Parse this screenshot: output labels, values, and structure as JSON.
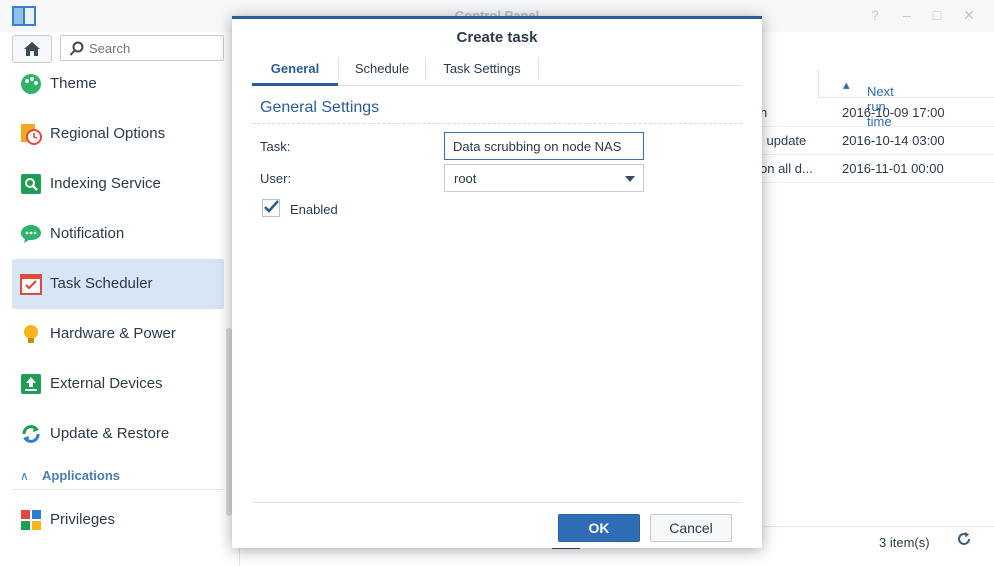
{
  "window": {
    "title": "Control Panel",
    "controls": [
      "?",
      "–",
      "□",
      "✕"
    ]
  },
  "sidebar": {
    "search_placeholder": "Search",
    "items": [
      {
        "label": "Theme",
        "icon": "palette-icon"
      },
      {
        "label": "Regional Options",
        "icon": "regional-clock-icon"
      },
      {
        "label": "Indexing Service",
        "icon": "indexing-search-icon"
      },
      {
        "label": "Notification",
        "icon": "chat-bubble-icon"
      },
      {
        "label": "Task Scheduler",
        "icon": "calendar-check-icon",
        "active": true
      },
      {
        "label": "Hardware & Power",
        "icon": "lightbulb-icon"
      },
      {
        "label": "External Devices",
        "icon": "upload-device-icon"
      },
      {
        "label": "Update & Restore",
        "icon": "refresh-cycle-icon"
      }
    ],
    "section": {
      "label": "Applications"
    },
    "apps": [
      {
        "label": "Privileges",
        "icon": "privileges-grid-icon"
      }
    ]
  },
  "content": {
    "columns": {
      "next_run": "Next run time"
    },
    "rows": [
      {
        "name": "n",
        "next_run": "2016-10-09 17:00"
      },
      {
        "name": "l update",
        "next_run": "2016-10-14 03:00"
      },
      {
        "name": "on all d...",
        "next_run": "2016-11-01 00:00"
      }
    ],
    "footer": {
      "count": "3 item(s)"
    }
  },
  "dialog": {
    "title": "Create task",
    "tabs": [
      "General",
      "Schedule",
      "Task Settings"
    ],
    "active_tab": "General",
    "section_title": "General Settings",
    "task_label": "Task:",
    "task_value": "Data scrubbing on node NAS",
    "user_label": "User:",
    "user_value": "root",
    "enabled_label": "Enabled",
    "enabled": true,
    "ok_label": "OK",
    "cancel_label": "Cancel"
  },
  "colors": {
    "accent": "#2b5d94",
    "primary_button": "#2f6db5",
    "active_sidebar": "#d6e6f5",
    "link_text": "#2b6cb0"
  }
}
